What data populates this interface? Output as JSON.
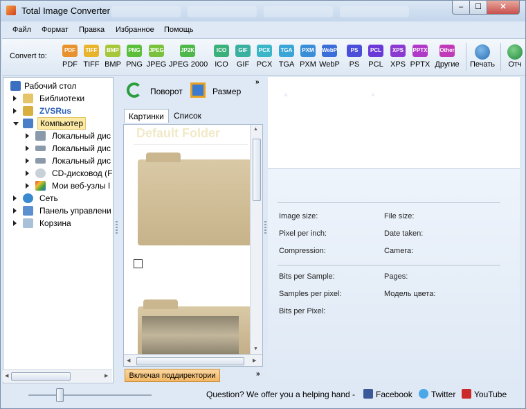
{
  "window": {
    "title": "Total Image Converter"
  },
  "menu": [
    "Файл",
    "Формат",
    "Правка",
    "Избранное",
    "Помощь"
  ],
  "toolbar": {
    "convert_label": "Convert to:",
    "formats": [
      {
        "icon": "PDF",
        "label": "PDF",
        "color": "#e8912d"
      },
      {
        "icon": "TIFF",
        "label": "TIFF",
        "color": "#e8b42d"
      },
      {
        "icon": "BMP",
        "label": "BMP",
        "color": "#a7c73a"
      },
      {
        "icon": "PNG",
        "label": "PNG",
        "color": "#5bbf3a"
      },
      {
        "icon": "JPEG",
        "label": "JPEG",
        "color": "#7ac23c"
      },
      {
        "icon": "JP2K",
        "label": "JPEG 2000",
        "color": "#4fb84a"
      },
      {
        "icon": "ICO",
        "label": "ICO",
        "color": "#3ab07a"
      },
      {
        "icon": "GIF",
        "label": "GIF",
        "color": "#3ab0a0"
      },
      {
        "icon": "PCX",
        "label": "PCX",
        "color": "#3ab6c8"
      },
      {
        "icon": "TGA",
        "label": "TGA",
        "color": "#3aa6d8"
      },
      {
        "icon": "PXM",
        "label": "PXM",
        "color": "#3a8ed8"
      },
      {
        "icon": "WebP",
        "label": "WebP",
        "color": "#3a6ed8"
      },
      {
        "icon": "PS",
        "label": "PS",
        "color": "#4a4ed8"
      },
      {
        "icon": "PCL",
        "label": "PCL",
        "color": "#6a3ad8"
      },
      {
        "icon": "XPS",
        "label": "XPS",
        "color": "#8a3ad0"
      },
      {
        "icon": "PPTX",
        "label": "PPTX",
        "color": "#b03ac8"
      },
      {
        "icon": "Other",
        "label": "Другие",
        "color": "#c03ab8"
      }
    ],
    "print_label": "Печать",
    "report_label": "Отч"
  },
  "tree": {
    "items": [
      {
        "label": "Рабочий стол",
        "icon": "desktop-icon"
      },
      {
        "label": "Библиотеки",
        "icon": "libraries-icon"
      },
      {
        "label": "ZVSRus",
        "icon": "user-folder-icon"
      },
      {
        "label": "Компьютер",
        "icon": "computer-icon"
      },
      {
        "label": "Локальный дис",
        "icon": "drive-icon"
      },
      {
        "label": "Локальный дис",
        "icon": "drive-icon"
      },
      {
        "label": "Локальный дис",
        "icon": "drive-icon"
      },
      {
        "label": "CD-дисковод (F",
        "icon": "cd-drive-icon"
      },
      {
        "label": "Мои веб-узлы I",
        "icon": "web-folders-icon"
      },
      {
        "label": "Сеть",
        "icon": "network-icon"
      },
      {
        "label": "Панель управлени",
        "icon": "control-panel-icon"
      },
      {
        "label": "Корзина",
        "icon": "recycle-bin-icon"
      }
    ]
  },
  "middle": {
    "rotate_label": "Поворот",
    "resize_label": "Размер",
    "tab_pictures": "Картинки",
    "tab_list": "Список",
    "faded_text": "Default Folder",
    "subdirs_button": "Включая поддиректории"
  },
  "info": {
    "image_size": "Image size:",
    "file_size": "File size:",
    "ppi": "Pixel per inch:",
    "date_taken": "Date taken:",
    "compression": "Compression:",
    "camera": "Camera:",
    "bits_per_sample": "Bits per Sample:",
    "pages": "Pages:",
    "samples_per_pixel": "Samples per pixel:",
    "color_model": "Модель цвета:",
    "bits_per_pixel": "Bits per Pixel:"
  },
  "status": {
    "question": "Question? We offer you a helping hand -",
    "facebook": "Facebook",
    "twitter": "Twitter",
    "youtube": "YouTube"
  }
}
